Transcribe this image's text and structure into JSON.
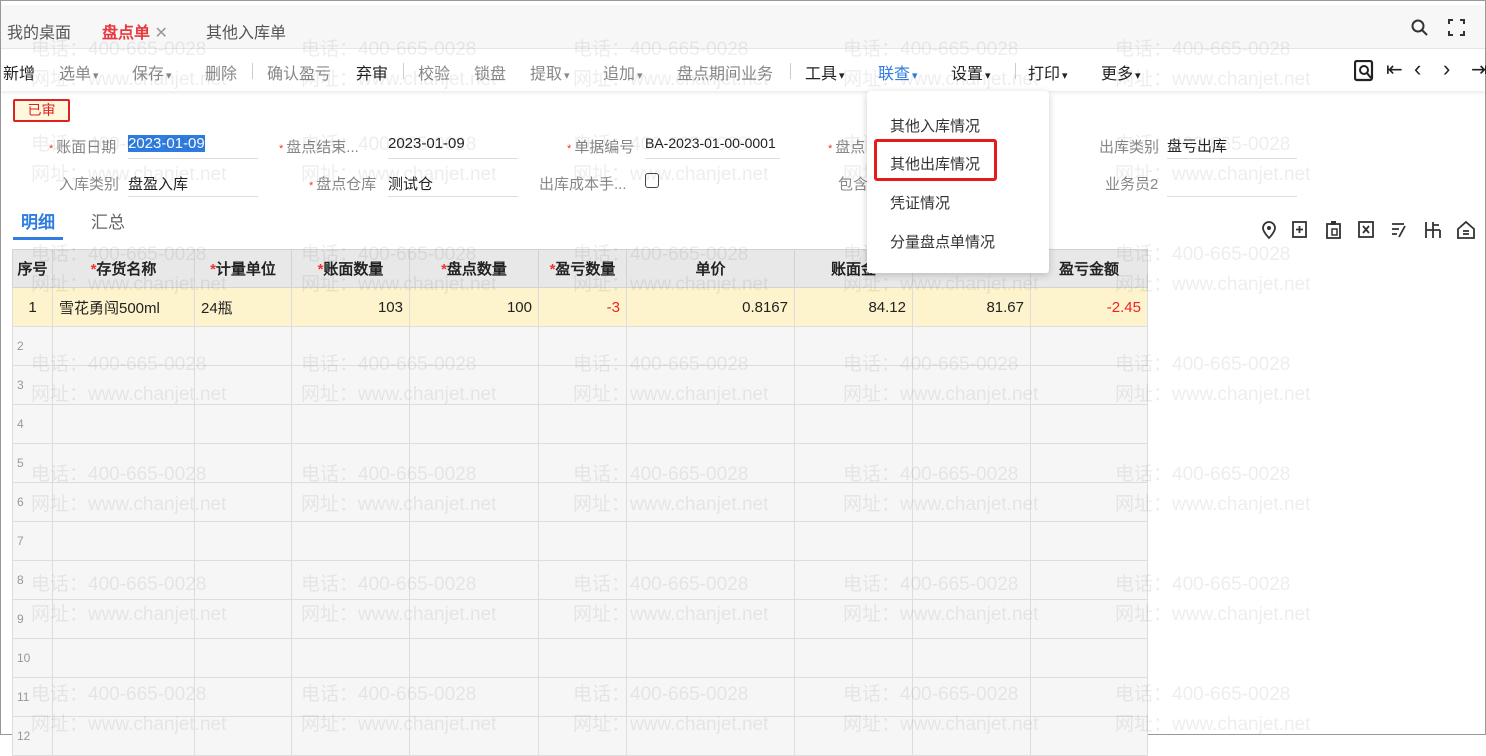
{
  "tabs": [
    {
      "label": "我的桌面"
    },
    {
      "label": "盘点单",
      "close": "✕"
    },
    {
      "label": "其他入库单"
    }
  ],
  "toolbar": {
    "new": "新增",
    "select": "选单",
    "save": "保存",
    "delete": "删除",
    "confirm": "确认盈亏",
    "abandon": "弃审",
    "verify": "校验",
    "lock": "锁盘",
    "extract": "提取",
    "append": "追加",
    "period": "盘点期间业务",
    "tools": "工具",
    "link": "联查",
    "settings": "设置",
    "print": "打印",
    "more": "更多"
  },
  "status_badge": "已审",
  "form": {
    "book_date_label": "账面日期",
    "book_date": "2023-01-09",
    "end_label": "盘点结束...",
    "end_date": "2023-01-09",
    "docno_label": "单据编号",
    "docno": "BA-2023-01-00-0001",
    "count_label": "盘点",
    "out_type_label": "出库类别",
    "out_type": "盘亏出库",
    "in_type_label": "入库类别",
    "in_type": "盘盈入库",
    "warehouse_label": "盘点仓库",
    "warehouse": "测试仓",
    "cost_label": "出库成本手...",
    "include_label": "包含",
    "clerk2_label": "业务员2"
  },
  "subtabs": [
    "明细",
    "汇总"
  ],
  "table": {
    "headers": [
      "序号",
      "存货名称",
      "计量单位",
      "账面数量",
      "盘点数量",
      "盈亏数量",
      "单价",
      "账面金",
      "",
      "盈亏金额"
    ],
    "required": [
      false,
      true,
      true,
      true,
      true,
      true,
      false,
      false,
      false,
      false
    ],
    "rows": [
      [
        "1",
        "雪花勇闯500ml",
        "24瓶",
        "103",
        "100",
        "-3",
        "0.8167",
        "84.12",
        "81.67",
        "-2.45"
      ]
    ],
    "empty_rows": [
      "2",
      "3",
      "4",
      "5",
      "6",
      "7",
      "8",
      "9",
      "10",
      "11",
      "12"
    ]
  },
  "dropdown": {
    "items": [
      "其他入库情况",
      "其他出库情况",
      "凭证情况",
      "分量盘点单情况"
    ],
    "highlighted": "其他出库情况"
  },
  "watermark": {
    "phone": "电话：400-665-0028",
    "site": "网址：www.chanjet.net"
  },
  "colors": {
    "accent": "#2f7de1",
    "active_tab": "#e8383d",
    "highlight": "#e31b1b"
  }
}
